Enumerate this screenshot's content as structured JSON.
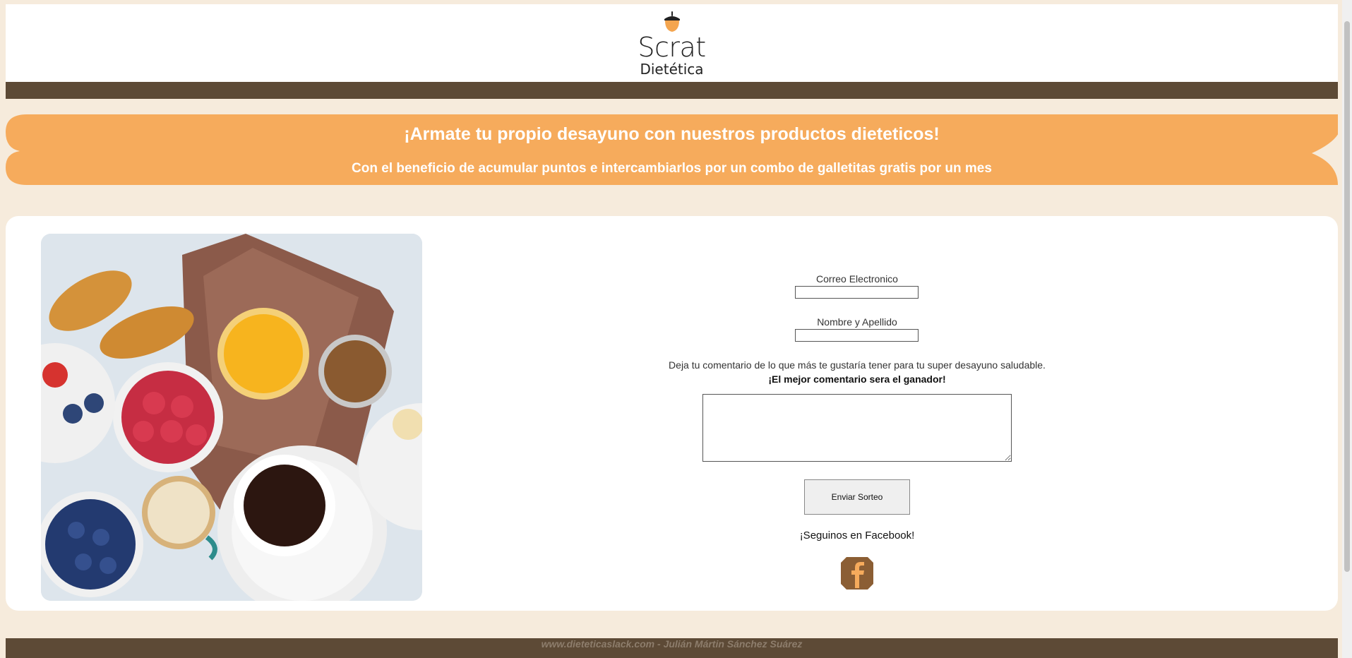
{
  "brand": {
    "name": "Scrat",
    "subtitle": "Dietética"
  },
  "banner": {
    "headline": "¡Armate tu propio desayuno con nuestros productos dieteticos!",
    "subline": "Con el beneficio de acumular puntos e intercambiarlos por un combo de galletitas gratis por un mes"
  },
  "form": {
    "email_label": "Correo Electronico",
    "email_value": "",
    "name_label": "Nombre y Apellido",
    "name_value": "",
    "comment_note": "Deja tu comentario de lo que más te gustaría tener para tu super desayuno saludable.",
    "comment_note_bold": "¡El mejor comentario sera el ganador!",
    "comment_value": "",
    "submit_label": "Enviar Sorteo",
    "follow_text": "¡Seguinos en Facebook!"
  },
  "footer": {
    "text": "www.dieteticaslack.com - Julián Mártin Sánchez Suárez"
  },
  "colors": {
    "background": "#f6ebdc",
    "brown": "#5d4a36",
    "orange": "#f6ab5c",
    "acorn": "#f4a54f",
    "facebook_bg": "#8b5e34",
    "facebook_f": "#f6ab5c"
  },
  "icons": {
    "logo": "acorn-icon",
    "social": "facebook-icon"
  }
}
